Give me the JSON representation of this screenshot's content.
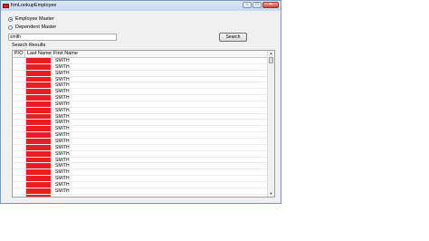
{
  "window": {
    "title": "frmLookupEmployee",
    "minimize_glyph": "–",
    "maximize_glyph": "□",
    "close_glyph": "✕"
  },
  "options": [
    {
      "label": "Employee Master",
      "checked": true
    },
    {
      "label": "Dependent Master",
      "checked": false
    }
  ],
  "search": {
    "value": "smith",
    "button_label": "Search"
  },
  "results": {
    "label": "Search Results",
    "columns": [
      "P/O",
      "Last Name",
      "First Name"
    ],
    "rows": [
      {
        "first_name": "SMITH"
      },
      {
        "first_name": "SMITH"
      },
      {
        "first_name": "SMITH"
      },
      {
        "first_name": "SMITH"
      },
      {
        "first_name": "SMITH"
      },
      {
        "first_name": "SMITH"
      },
      {
        "first_name": "SMITH"
      },
      {
        "first_name": "SMITH"
      },
      {
        "first_name": "SMITH"
      },
      {
        "first_name": "SMITH"
      },
      {
        "first_name": "SMITH"
      },
      {
        "first_name": "SMITH"
      },
      {
        "first_name": "SMITH"
      },
      {
        "first_name": "SMITH"
      },
      {
        "first_name": "SMITH"
      },
      {
        "first_name": "SMITH"
      },
      {
        "first_name": "SMITH"
      },
      {
        "first_name": "SMITH"
      },
      {
        "first_name": "SMITH"
      },
      {
        "first_name": "SMITH"
      },
      {
        "first_name": "SMITH"
      },
      {
        "first_name": "SMITH"
      }
    ],
    "last_name_fill_color": "#ec1c24"
  },
  "scrollbar": {
    "up_glyph": "▲",
    "down_glyph": "▼"
  }
}
